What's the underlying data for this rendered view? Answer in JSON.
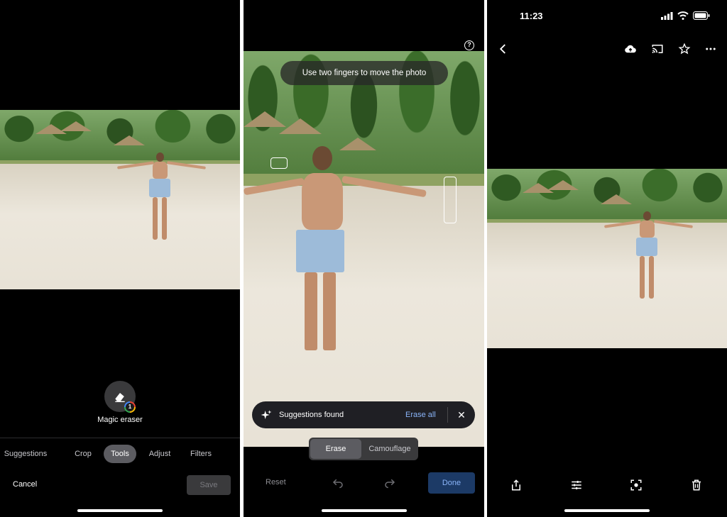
{
  "editor": {
    "tool_label": "Magic eraser",
    "badge_number": "1",
    "tabs": [
      "Suggestions",
      "Crop",
      "Tools",
      "Adjust",
      "Filters"
    ],
    "active_tab": "Tools",
    "cancel_label": "Cancel",
    "save_label": "Save"
  },
  "eraser": {
    "hint": "Use two fingers to move the photo",
    "help_glyph": "?",
    "suggestions_text": "Suggestions found",
    "erase_all_label": "Erase all",
    "close_glyph": "✕",
    "modes": [
      "Erase",
      "Camouflage"
    ],
    "active_mode": "Erase",
    "reset_label": "Reset",
    "done_label": "Done"
  },
  "viewer": {
    "time": "11:23",
    "top_icons": [
      "back-icon",
      "cloud-upload-icon",
      "cast-icon",
      "star-icon",
      "more-icon"
    ],
    "bottom_icons": [
      "share-icon",
      "edit-sliders-icon",
      "lens-icon",
      "trash-icon"
    ]
  },
  "colors": {
    "background": "#000000",
    "accent_blue": "#8ab4f8",
    "done_button": "#1c3a66",
    "active_chip": "#5c5c61"
  }
}
